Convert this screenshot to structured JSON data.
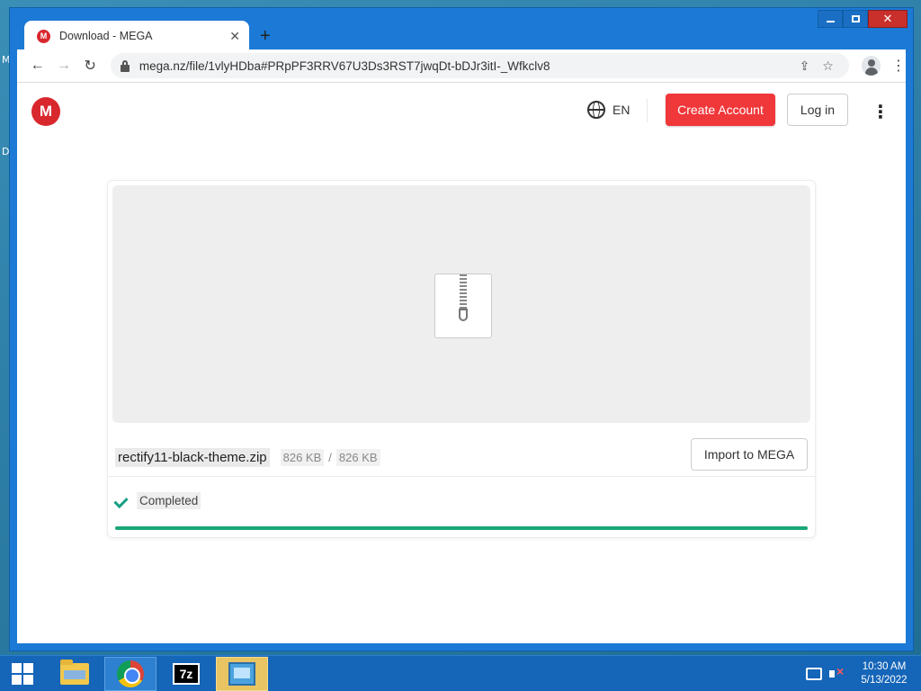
{
  "desktop": {
    "peek_top": "M",
    "peek_mid": "D"
  },
  "browser": {
    "tab_title": "Download - MEGA",
    "favicon_letter": "M",
    "url": "mega.nz/file/1vlyHDba#PRpPF3RRV67U3Ds3RST7jwqDt-bDJr3itI-_Wfkclv8"
  },
  "header": {
    "logo_letter": "M",
    "language": "EN",
    "create_account_label": "Create Account",
    "login_label": "Log in"
  },
  "file": {
    "name": "rectify11-black-theme.zip",
    "downloaded": "826 KB",
    "separator": "/",
    "total": "826 KB",
    "import_label": "Import to MEGA",
    "status": "Completed",
    "progress_percent": 100
  },
  "taskbar": {
    "sevenzip_label": "7z",
    "time": "10:30 AM",
    "date": "5/13/2022"
  },
  "colors": {
    "brand_red": "#d9272e",
    "create_button": "#f0373a",
    "progress_green": "#1aa777",
    "window_blue": "#1c7ad6"
  }
}
